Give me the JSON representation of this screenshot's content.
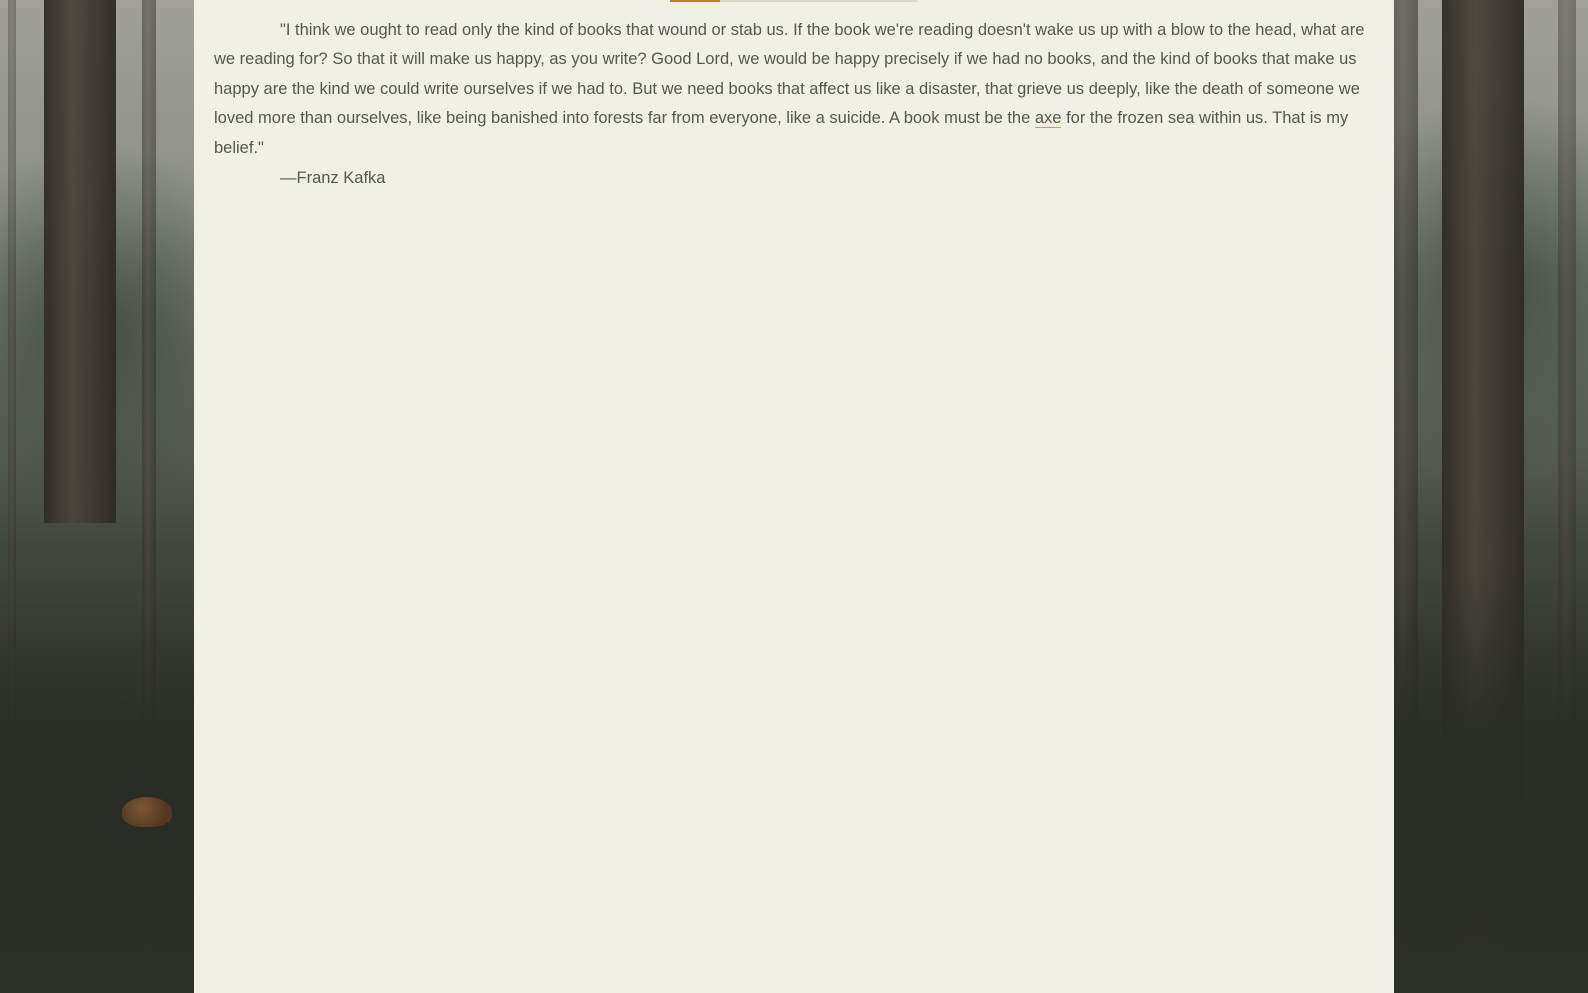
{
  "quote": {
    "text_before": "\"I think we ought to read only the kind of books that wound or stab us. If the book we're reading doesn't wake us up with a blow to the head, what are we reading for? So that it will make us happy, as you write? Good Lord, we would be happy precisely if we had no books, and the kind of books that make us happy are the kind we could write ourselves if we had to. But we need books that affect us like a disaster, that grieve us deeply, like the death of someone we loved more than ourselves, like being banished into forests far from everyone, like a suicide. A book must be the ",
    "link_text": "axe",
    "text_after": " for the frozen sea within us. That is my belief.\"",
    "attribution": "—Franz Kafka"
  },
  "colors": {
    "accent": "#c27a2c",
    "link_underline": "#d89a4a",
    "page_background": "#f1f0e5",
    "text": "#55584f"
  }
}
